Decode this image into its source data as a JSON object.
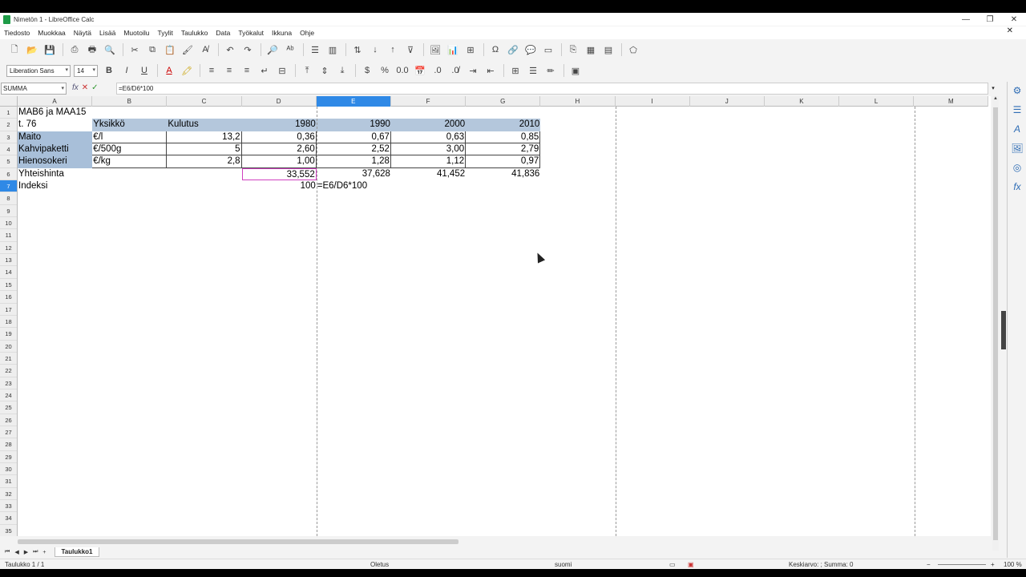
{
  "window": {
    "title": "Nimetön 1 - LibreOffice Calc",
    "controls": [
      "—",
      "❐",
      "✕"
    ]
  },
  "menu": [
    "Tiedosto",
    "Muokkaa",
    "Näytä",
    "Lisää",
    "Muotoilu",
    "Tyylit",
    "Taulukko",
    "Data",
    "Työkalut",
    "Ikkuna",
    "Ohje"
  ],
  "toolbar": {
    "font_name": "Liberation Sans",
    "font_size": "14"
  },
  "formula_bar": {
    "name_box": "SUMMA",
    "formula": "=E6/D6*100"
  },
  "columns": [
    "A",
    "B",
    "C",
    "D",
    "E",
    "F",
    "G",
    "H",
    "I",
    "J",
    "K",
    "L",
    "M"
  ],
  "selected_column": "E",
  "selected_row": "7",
  "rows": [
    "1",
    "2",
    "3",
    "4",
    "5",
    "6",
    "7",
    "8",
    "9",
    "10",
    "11",
    "12",
    "13",
    "14",
    "15",
    "16",
    "17",
    "18",
    "19",
    "20",
    "21",
    "22",
    "23",
    "24",
    "25",
    "26",
    "27",
    "28",
    "29",
    "30",
    "31",
    "32",
    "33",
    "34",
    "35"
  ],
  "cells": {
    "A1": "MAB6 ja MAA15",
    "A2": "t. 76",
    "B2": "Yksikkö",
    "C2": "Kulutus",
    "D2": "1980",
    "E2": "1990",
    "F2": "2000",
    "G2": "2010",
    "A3": "Maito",
    "B3": "€/l",
    "C3": "13,2",
    "D3": "0,36",
    "E3": "0,67",
    "F3": "0,63",
    "G3": "0,85",
    "A4": "Kahvipaketti",
    "B4": "€/500g",
    "C4": "5",
    "D4": "2,60",
    "E4": "2,52",
    "F4": "3,00",
    "G4": "2,79",
    "A5": "Hienosokeri",
    "B5": "€/kg",
    "C5": "2,8",
    "D5": "1,00",
    "E5": "1,28",
    "F5": "1,12",
    "G5": "0,97",
    "A6": "Yhteishinta",
    "D6": "33,552",
    "E6": "37,628",
    "F6": "41,452",
    "G6": "41,836",
    "A7": "Indeksi",
    "D7": "100",
    "E7": "=E6/D6*100"
  },
  "sheet": {
    "tab": "Taulukko1",
    "add_symbol": "+"
  },
  "status": {
    "sheet_pos": "Taulukko 1 / 1",
    "style": "Oletus",
    "language": "suomi",
    "summary": "Keskiarvo: ; Summa: 0",
    "zoom": "100 %"
  }
}
